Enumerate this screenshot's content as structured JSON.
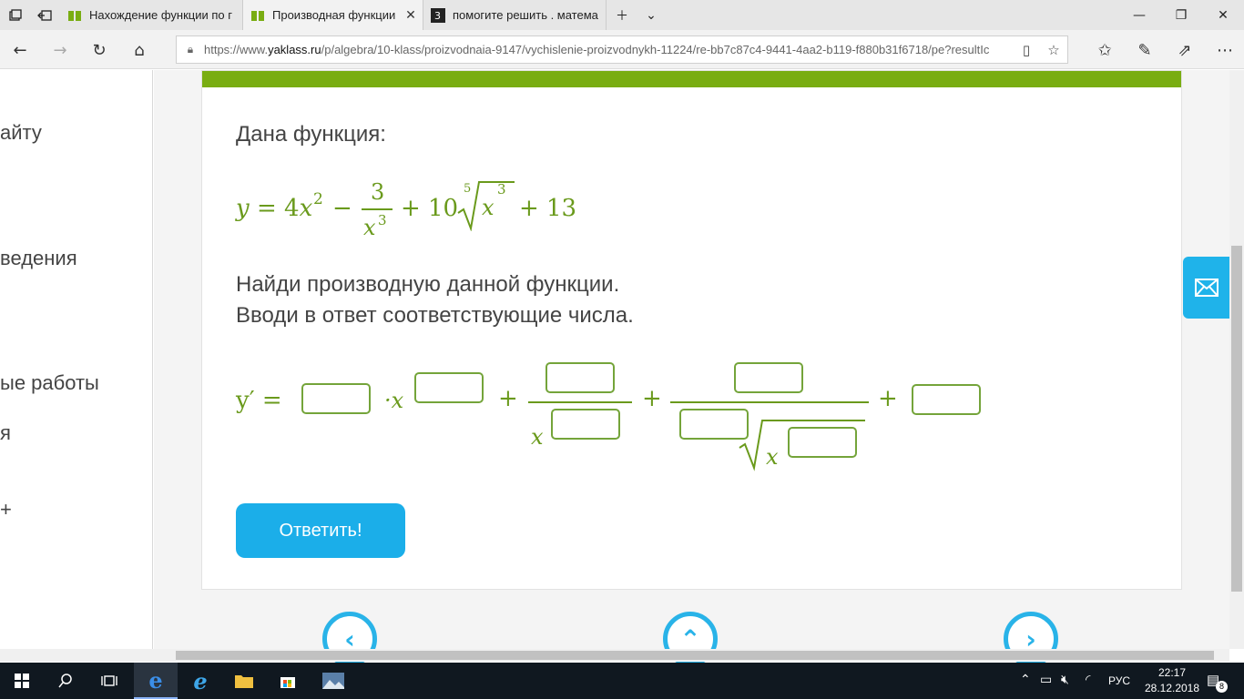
{
  "browser": {
    "tabs": [
      {
        "title": "Нахождение функции по г",
        "favicon": "yaklass-book-icon",
        "active": false
      },
      {
        "title": "Производная функции",
        "favicon": "yaklass-book-icon",
        "active": true
      },
      {
        "title": "помогите решить . матема",
        "favicon": "znanija-icon",
        "active": false
      }
    ],
    "url_prefix": "https://www.",
    "url_domain": "yaklass.ru",
    "url_path": "/p/algebra/10-klass/proizvodnaia-9147/vychislenie-proizvodnykh-11224/re-bb7c87c4-9441-4aa2-b119-f880b31f6718/pe?resultIc"
  },
  "sidebar": {
    "items": [
      "айту",
      "ведения",
      "ые работы",
      "я",
      "+"
    ]
  },
  "task": {
    "intro": "Дана функция:",
    "formula": {
      "y": "y",
      "eq": "=",
      "c1": "4",
      "x": "x",
      "p2": "2",
      "minus": "−",
      "num3": "3",
      "p3": "3",
      "plus": "+",
      "c10": "10",
      "root_index": "5",
      "c13": "13"
    },
    "instruction_1": "Найди производную данной функции.",
    "instruction_2": "Вводи в ответ соответствующие числа.",
    "answer": {
      "lhs": "y′ =",
      "dot_x": "·x",
      "plus": "+",
      "x": "x"
    },
    "submit_label": "Ответить!"
  },
  "taskbar": {
    "language": "РУС",
    "time": "22:17",
    "date": "28.12.2018",
    "notifications": "8"
  },
  "colors": {
    "accent_green": "#79ad12",
    "math_green": "#6a9a1c",
    "button_blue": "#1baee9"
  }
}
